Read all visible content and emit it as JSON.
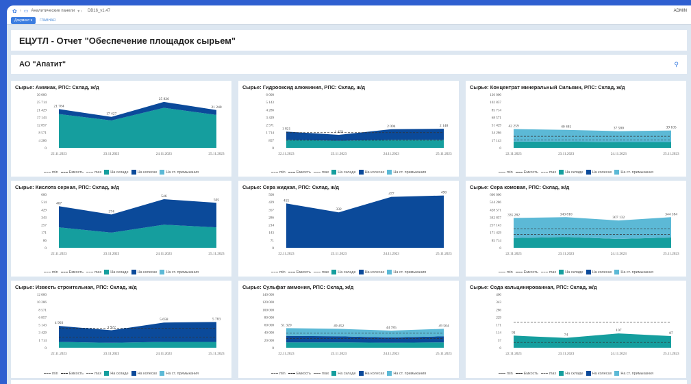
{
  "topbar": {
    "breadcrumb_1": "Аналитические панели",
    "breadcrumb_2": "DB16_v1.47",
    "user": "ADMIN"
  },
  "tabs": {
    "document": "Документ ▾",
    "main": "ГЛАВНАЯ"
  },
  "page_title": "ЕЦУТЛ - Отчет \"Обеспечение площадок сырьем\"",
  "section_title": "АО \"Апатит\"",
  "colors": {
    "na_sklade": "#159e9e",
    "na_kolesah": "#0b4a9a",
    "na_primykaniya": "#5cb9d6"
  },
  "legend": {
    "min": "min",
    "emkost": "Емкость",
    "max": "max",
    "na_sklade": "На складе",
    "na_kolesah": "На колесах",
    "na_primykaniya": "На ст. примыкания"
  },
  "chart_data": [
    {
      "type": "area",
      "title": "Сырье: Аммиак, РПС: Склад, ж/д",
      "x": [
        "22.11.2023",
        "23.11.2023",
        "24.11.2023",
        "25.11.2023"
      ],
      "yticks": [
        "30 000",
        "25 714",
        "21 429",
        "17 143",
        "12 857",
        "8 571",
        "4 286",
        "0"
      ],
      "ymax": 30000,
      "totals": [
        21784,
        17427,
        25826,
        21248
      ],
      "total_labels": [
        "21 784",
        "17 427",
        "25 826",
        "21 248"
      ],
      "series": [
        {
          "name": "На складе",
          "values": [
            19000,
            15400,
            22500,
            18500
          ]
        },
        {
          "name": "На колесах",
          "values": [
            2784,
            2027,
            3326,
            2748
          ]
        },
        {
          "name": "На ст. примыкания",
          "values": [
            0,
            0,
            0,
            0
          ]
        }
      ],
      "lines": []
    },
    {
      "type": "area",
      "title": "Сырье: Гидрооксид алюминия, РПС: Склад, ж/д",
      "x": [
        "22.11.2023",
        "23.11.2023",
        "24.11.2023",
        "25.11.2023"
      ],
      "yticks": [
        "6 000",
        "5 143",
        "4 286",
        "3 429",
        "2 571",
        "1 714",
        "857",
        "0"
      ],
      "ymax": 6000,
      "totals": [
        1821,
        1459,
        2094,
        2148
      ],
      "total_labels": [
        "1 821",
        "1 459",
        "2 094",
        "2 148"
      ],
      "series": [
        {
          "name": "На складе",
          "values": [
            900,
            800,
            900,
            900
          ]
        },
        {
          "name": "На колесах",
          "values": [
            921,
            659,
            1194,
            1248
          ]
        },
        {
          "name": "На ст. примыкания",
          "values": [
            0,
            0,
            0,
            0
          ]
        }
      ],
      "lines": [
        {
          "value": 1714,
          "style": "dash"
        },
        {
          "value": 857,
          "style": "dash"
        }
      ]
    },
    {
      "type": "area",
      "title": "Сырье: Концентрат минеральный Сильвин, РПС: Склад, ж/д",
      "x": [
        "22.11.2023",
        "23.11.2023",
        "24.11.2023",
        "25.11.2023"
      ],
      "yticks": [
        "120 000",
        "102 857",
        "85 714",
        "68 571",
        "51 429",
        "34 286",
        "17 143",
        "0"
      ],
      "ymax": 120000,
      "totals": [
        42259,
        40481,
        37580,
        39105
      ],
      "total_labels": [
        "42 259",
        "40 481",
        "37 580",
        "39 105"
      ],
      "series": [
        {
          "name": "На складе",
          "values": [
            14000,
            14000,
            13000,
            13000
          ]
        },
        {
          "name": "На колесах",
          "values": [
            0,
            0,
            0,
            0
          ]
        },
        {
          "name": "На ст. примыкания",
          "values": [
            28259,
            26481,
            24580,
            26105
          ]
        }
      ],
      "lines": [
        {
          "value": 26000,
          "style": "dash"
        },
        {
          "value": 18000,
          "style": "dash"
        }
      ]
    },
    {
      "type": "area",
      "title": "Сырье: Кислота серная, РПС: Склад, ж/д",
      "x": [
        "22.11.2023",
        "23.11.2023",
        "24.11.2023",
        "25.11.2023"
      ],
      "yticks": [
        "600",
        "514",
        "429",
        "343",
        "257",
        "171",
        "86",
        "0"
      ],
      "ymax": 600,
      "totals": [
        467,
        374,
        546,
        505
      ],
      "total_labels": [
        "467",
        "374",
        "546",
        "505"
      ],
      "series": [
        {
          "name": "На складе",
          "values": [
            230,
            170,
            260,
            230
          ]
        },
        {
          "name": "На колесах",
          "values": [
            237,
            204,
            286,
            275
          ]
        },
        {
          "name": "На ст. примыкания",
          "values": [
            0,
            0,
            0,
            0
          ]
        }
      ],
      "lines": []
    },
    {
      "type": "area",
      "title": "Сырье: Сера жидкая, РПС: Склад, ж/д",
      "x": [
        "22.11.2023",
        "23.11.2023",
        "24.11.2023",
        "25.11.2023"
      ],
      "yticks": [
        "500",
        "429",
        "357",
        "286",
        "214",
        "143",
        "71",
        "0"
      ],
      "ymax": 500,
      "totals": [
        415,
        332,
        477,
        490
      ],
      "total_labels": [
        "415",
        "332",
        "477",
        "490"
      ],
      "series": [
        {
          "name": "На складе",
          "values": [
            0,
            0,
            0,
            0
          ]
        },
        {
          "name": "На колесах",
          "values": [
            415,
            332,
            477,
            490
          ]
        },
        {
          "name": "На ст. примыкания",
          "values": [
            0,
            0,
            0,
            0
          ]
        }
      ],
      "lines": []
    },
    {
      "type": "area",
      "title": "Сырье: Сера комовая, РПС: Склад, ж/д",
      "x": [
        "22.11.2023",
        "23.11.2023",
        "24.11.2023",
        "25.11.2023"
      ],
      "yticks": [
        "600 000",
        "514 286",
        "428 571",
        "342 857",
        "257 143",
        "171 429",
        "85 714",
        "0"
      ],
      "ymax": 600000,
      "totals": [
        335282,
        343810,
        307132,
        344184
      ],
      "total_labels": [
        "335 282",
        "343 810",
        "307 132",
        "344 184"
      ],
      "series": [
        {
          "name": "На складе",
          "values": [
            110000,
            120000,
            100000,
            115000
          ]
        },
        {
          "name": "На колесах",
          "values": [
            0,
            0,
            0,
            0
          ]
        },
        {
          "name": "На ст. примыкания",
          "values": [
            225282,
            223810,
            207132,
            229184
          ]
        }
      ],
      "lines": [
        {
          "value": 215000,
          "style": "dash"
        },
        {
          "value": 150000,
          "style": "dash"
        }
      ]
    },
    {
      "type": "area",
      "title": "Сырье: Известь строительная, РПС: Склад, ж/д",
      "x": [
        "22.11.2023",
        "23.11.2023",
        "24.11.2023",
        "25.11.2023"
      ],
      "yticks": [
        "12 000",
        "10 286",
        "8 571",
        "6 857",
        "5 143",
        "3 429",
        "1 714",
        "0"
      ],
      "ymax": 12000,
      "totals": [
        4903,
        3922,
        5658,
        5783
      ],
      "total_labels": [
        "4 903",
        "3 922",
        "5 658",
        "5 783"
      ],
      "series": [
        {
          "name": "На складе",
          "values": [
            1300,
            1100,
            1300,
            1300
          ]
        },
        {
          "name": "На колесах",
          "values": [
            3603,
            2822,
            4358,
            4483
          ]
        },
        {
          "name": "На ст. примыкания",
          "values": [
            0,
            0,
            0,
            0
          ]
        }
      ],
      "lines": [
        {
          "value": 4400,
          "style": "dash"
        },
        {
          "value": 2400,
          "style": "dash"
        }
      ]
    },
    {
      "type": "area",
      "title": "Сырье: Сульфат аммония, РПС: Склад, ж/д",
      "x": [
        "22.11.2023",
        "23.11.2023",
        "24.11.2023",
        "25.11.2023"
      ],
      "yticks": [
        "140 000",
        "120 000",
        "100 000",
        "80 000",
        "60 000",
        "40 000",
        "20 000",
        "0"
      ],
      "ymax": 140000,
      "totals": [
        51320,
        49452,
        44785,
        49504
      ],
      "total_labels": [
        "51 320",
        "49 452",
        "44 785",
        "49 504"
      ],
      "series": [
        {
          "name": "На складе",
          "values": [
            14000,
            14000,
            13000,
            14000
          ]
        },
        {
          "name": "На колесах",
          "values": [
            17000,
            16000,
            14000,
            16000
          ]
        },
        {
          "name": "На ст. примыкания",
          "values": [
            20320,
            19452,
            17785,
            19504
          ]
        }
      ],
      "lines": [
        {
          "value": 38000,
          "style": "dash"
        },
        {
          "value": 24000,
          "style": "dash"
        }
      ]
    },
    {
      "type": "area",
      "title": "Сырье: Сода кальцинированная, РПС: Склад, ж/д",
      "x": [
        "22.11.2023",
        "23.11.2023",
        "24.11.2023",
        "25.11.2023"
      ],
      "yticks": [
        "400",
        "343",
        "286",
        "229",
        "171",
        "114",
        "57",
        "0"
      ],
      "ymax": 400,
      "totals": [
        91,
        74,
        107,
        87
      ],
      "total_labels": [
        "91",
        "74",
        "107",
        "87"
      ],
      "series": [
        {
          "name": "На складе",
          "values": [
            91,
            74,
            107,
            87
          ]
        },
        {
          "name": "На колесах",
          "values": [
            0,
            0,
            0,
            0
          ]
        },
        {
          "name": "На ст. примыкания",
          "values": [
            0,
            0,
            0,
            0
          ]
        }
      ],
      "lines": [
        {
          "value": 190,
          "style": "dash"
        },
        {
          "value": 40,
          "style": "dash"
        }
      ]
    }
  ]
}
